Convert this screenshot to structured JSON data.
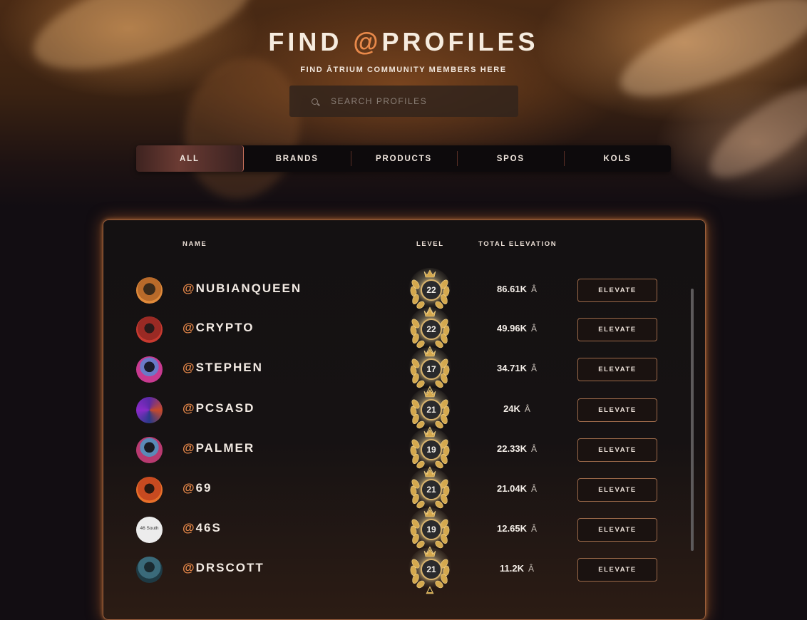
{
  "header": {
    "title_prefix": "FIND ",
    "title_accent": "@",
    "title_suffix": "PROFILES",
    "subtitle": "FIND ÂTRIUM COMMUNITY MEMBERS HERE"
  },
  "search": {
    "placeholder": "SEARCH PROFILES",
    "icon": "search-icon"
  },
  "tabs": [
    {
      "label": "ALL",
      "active": true
    },
    {
      "label": "BRANDS",
      "active": false
    },
    {
      "label": "PRODUCTS",
      "active": false
    },
    {
      "label": "SPOS",
      "active": false
    },
    {
      "label": "KOLS",
      "active": false
    }
  ],
  "table": {
    "columns": {
      "name": "NAME",
      "level": "LEVEL",
      "elevation": "TOTAL ELEVATION"
    },
    "button_label": "ELEVATE",
    "currency_symbol": "Â",
    "rows": [
      {
        "handle": "NUBIANQUEEN",
        "level": "22",
        "elevation": "86.61K"
      },
      {
        "handle": "CRYPTO",
        "level": "22",
        "elevation": "49.96K"
      },
      {
        "handle": "STEPHEN",
        "level": "17",
        "elevation": "34.71K"
      },
      {
        "handle": "PCSASD",
        "level": "21",
        "elevation": "24K"
      },
      {
        "handle": "PALMER",
        "level": "19",
        "elevation": "22.33K"
      },
      {
        "handle": "69",
        "level": "21",
        "elevation": "21.04K"
      },
      {
        "handle": "46S",
        "level": "19",
        "elevation": "12.65K",
        "avatar_text": "46 South"
      },
      {
        "handle": "DRSCOTT",
        "level": "21",
        "elevation": "11.2K"
      }
    ]
  },
  "colors": {
    "accent": "#e8894a",
    "panel_border": "#9b5f3c",
    "badge_gold": "#d8b36c"
  }
}
